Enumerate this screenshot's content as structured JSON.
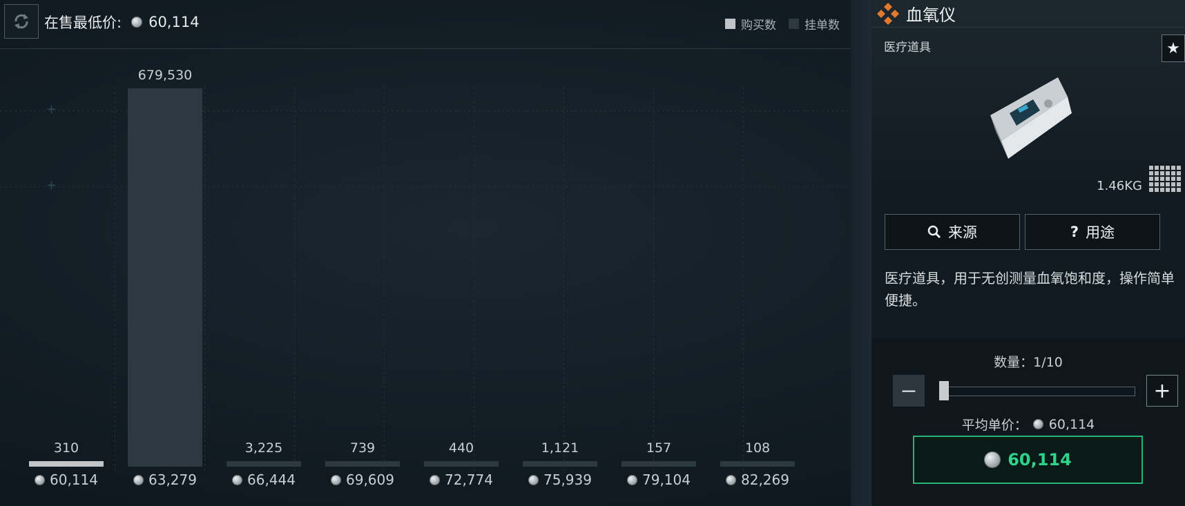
{
  "market": {
    "lowest_label": "在售最低价:",
    "lowest_price": "60,114",
    "legend": [
      {
        "label": "购买数",
        "color": "#bfc5c8"
      },
      {
        "label": "挂单数",
        "color": "#2c3940"
      }
    ]
  },
  "chart_data": {
    "type": "bar",
    "categories": [
      "60,114",
      "63,279",
      "66,444",
      "69,609",
      "72,774",
      "75,939",
      "79,104",
      "82,269"
    ],
    "series": [
      {
        "name": "挂单数",
        "values": [
          310,
          679530,
          3225,
          739,
          440,
          1121,
          157,
          108
        ]
      }
    ],
    "value_labels": [
      "310",
      "679,530",
      "3,225",
      "739",
      "440",
      "1,121",
      "157",
      "108"
    ],
    "ylim": [
      0,
      679530
    ],
    "grid": true,
    "legend_position": "top-right",
    "colors": {
      "selected": "#bfc5c8",
      "normal": "#2c3940"
    }
  },
  "item": {
    "name": "血氧仪",
    "category": "医疗道具",
    "weight": "1.46KG",
    "source_label": "来源",
    "usage_label": "用途",
    "description": "医疗道具，用于无创测量血氧饱和度，操作简单便捷。",
    "quantity_label": "数量：1/10",
    "quantity": 1,
    "quantity_max": 10,
    "avg_price_label": "平均单价：",
    "avg_price": "60,114",
    "buy_price": "60,114",
    "accent": "#2fd38c"
  }
}
